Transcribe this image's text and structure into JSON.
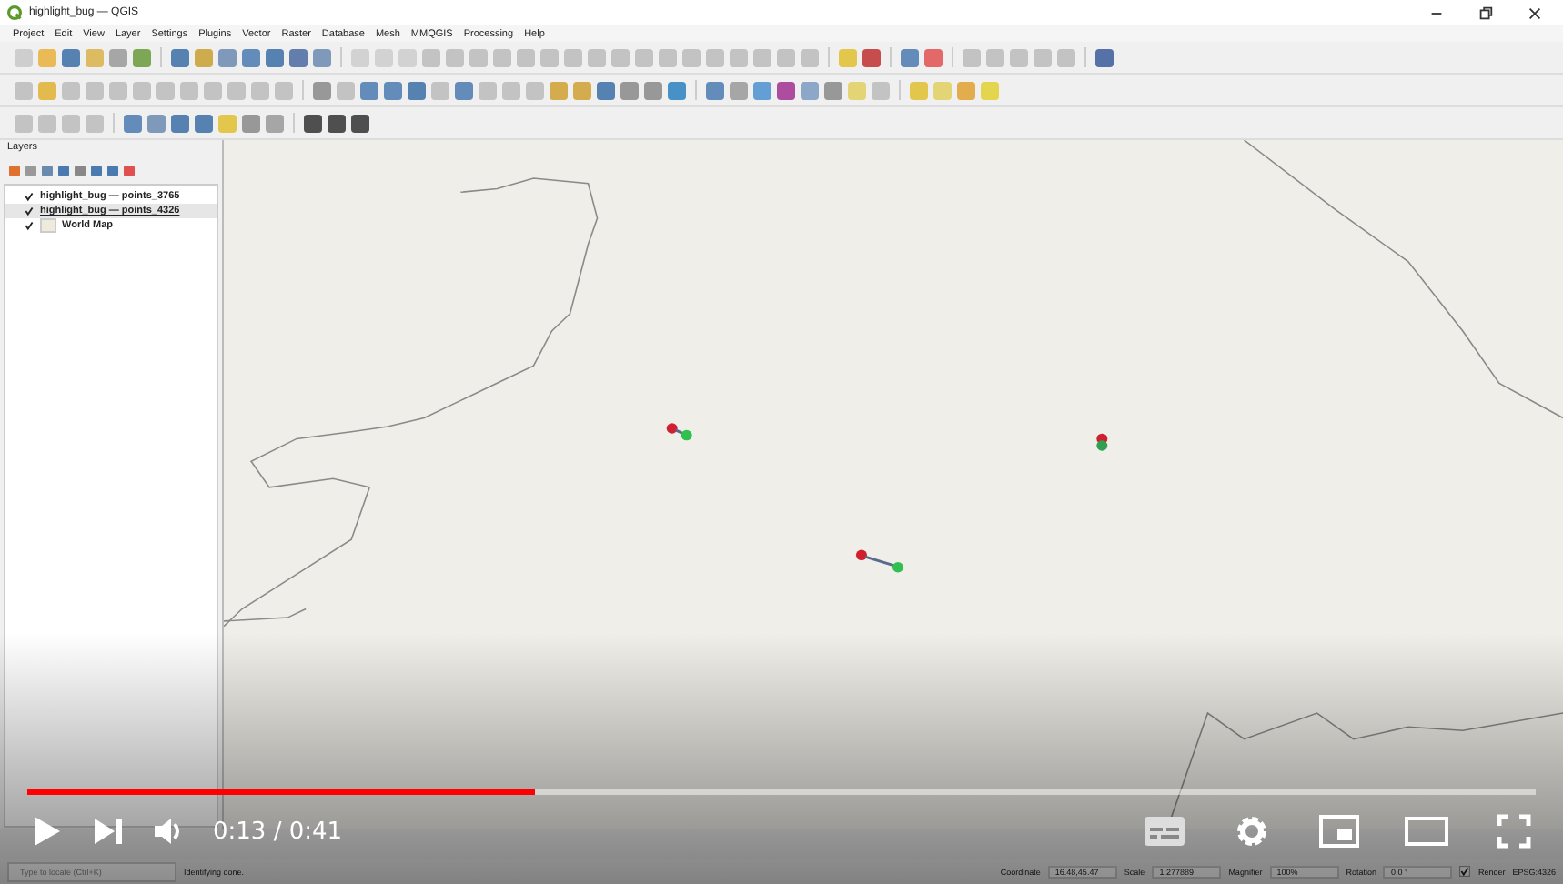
{
  "window": {
    "title": "highlight_bug — QGIS"
  },
  "menu": [
    "Project",
    "Edit",
    "View",
    "Layer",
    "Settings",
    "Plugins",
    "Vector",
    "Raster",
    "Database",
    "Mesh",
    "MMQGIS",
    "Processing",
    "Help"
  ],
  "layers_panel": {
    "title": "Layers",
    "layers": [
      {
        "name": "highlight_bug — points_3765",
        "checked": true,
        "selected": false
      },
      {
        "name": "highlight_bug — points_4326",
        "checked": true,
        "selected": true
      },
      {
        "name": "World Map",
        "checked": true,
        "selected": false
      }
    ]
  },
  "status_bar": {
    "locator": {
      "placeholder": "Type to locate (Ctrl+K)"
    },
    "message": "Identifying done.",
    "coordinate_label": "Coordinate",
    "coordinate": "16.48,45.47",
    "scale_label": "Scale",
    "scale": "1:277889",
    "magnifier_label": "Magnifier",
    "magnifier": "100%",
    "rotation_label": "Rotation",
    "rotation": "0.0 °",
    "render": {
      "label": "Render",
      "checked": true
    },
    "crs": "EPSG:4326"
  },
  "video": {
    "time": "0:13 / 0:41",
    "progress": {
      "level": 0.336
    }
  }
}
